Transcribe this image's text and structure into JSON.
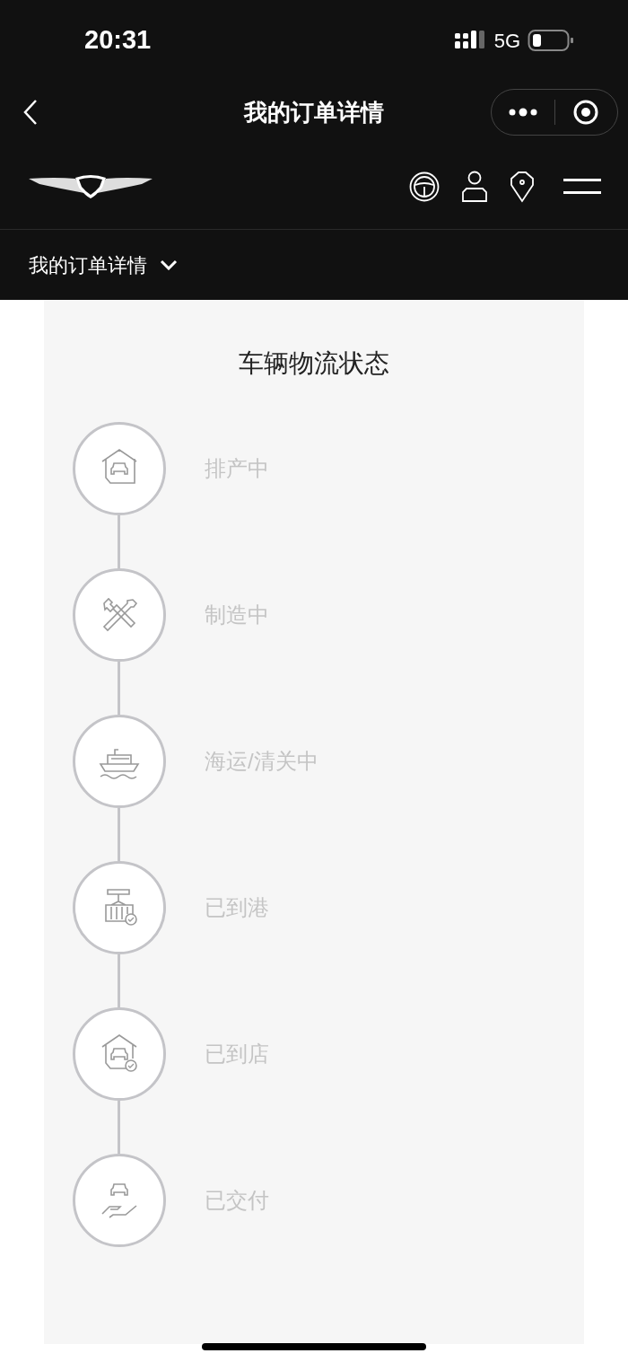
{
  "status_bar": {
    "time": "20:31",
    "network": "5G"
  },
  "title_bar": {
    "title": "我的订单详情"
  },
  "breadcrumb": {
    "label": "我的订单详情"
  },
  "card": {
    "title": "车辆物流状态",
    "steps": [
      {
        "kind": "factory",
        "label": "排产中"
      },
      {
        "kind": "tools",
        "label": "制造中"
      },
      {
        "kind": "ship",
        "label": "海运/清关中"
      },
      {
        "kind": "port",
        "label": "已到港"
      },
      {
        "kind": "store",
        "label": "已到店"
      },
      {
        "kind": "delivery",
        "label": "已交付"
      }
    ]
  }
}
